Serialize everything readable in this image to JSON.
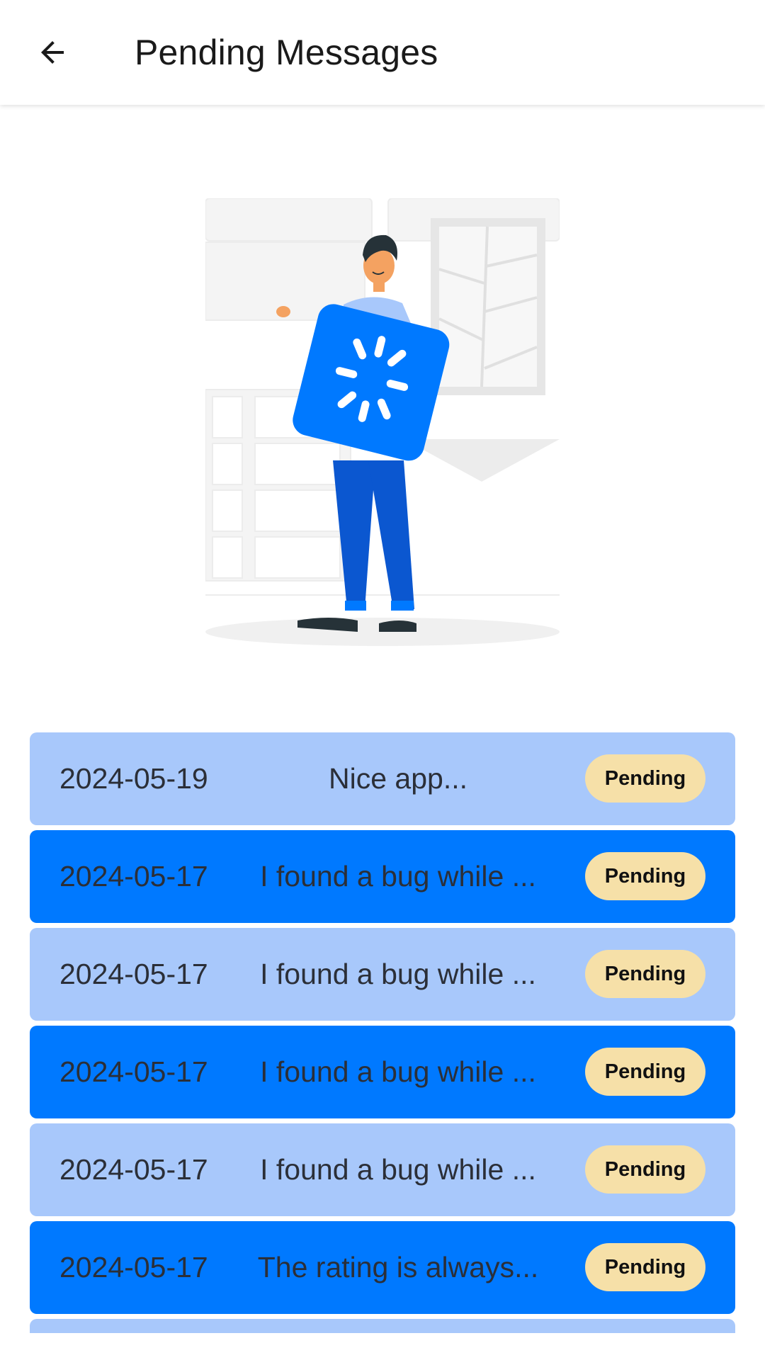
{
  "app_bar": {
    "title": "Pending Messages",
    "back_icon": "arrow-left-icon"
  },
  "illustration": {
    "icon": "loading-spinner-icon",
    "description_colors": {
      "accent": "#0079ff",
      "pants": "#0b57d0",
      "shirt": "#a8c8fb"
    }
  },
  "colors": {
    "row_light": "#a8c8fb",
    "row_dark": "#0079ff",
    "badge": "#f6e0a8"
  },
  "messages": [
    {
      "date": "2024-05-19",
      "preview": "Nice app...",
      "status": "Pending"
    },
    {
      "date": "2024-05-17",
      "preview": "I found a bug while ...",
      "status": "Pending"
    },
    {
      "date": "2024-05-17",
      "preview": "I found a bug while ...",
      "status": "Pending"
    },
    {
      "date": "2024-05-17",
      "preview": "I found a bug while ...",
      "status": "Pending"
    },
    {
      "date": "2024-05-17",
      "preview": "I found a bug while ...",
      "status": "Pending"
    },
    {
      "date": "2024-05-17",
      "preview": "The rating is always...",
      "status": "Pending"
    }
  ]
}
